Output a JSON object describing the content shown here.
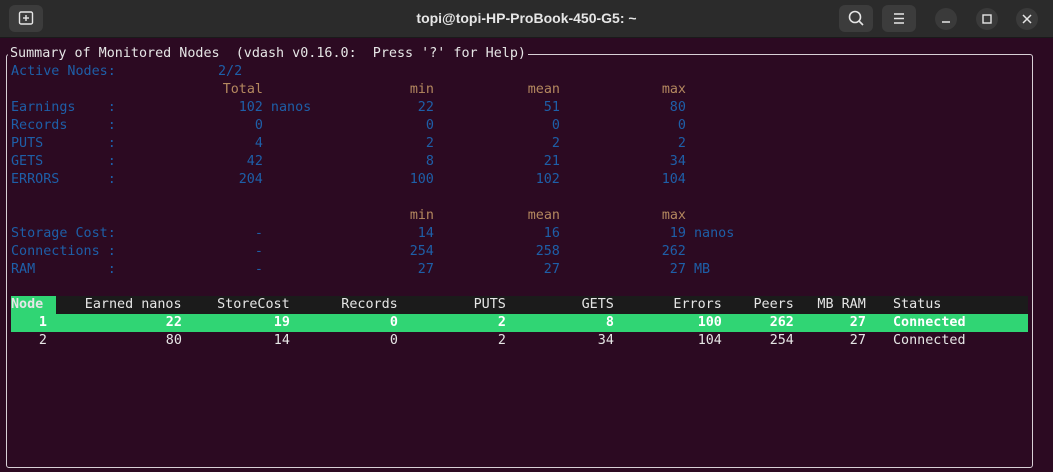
{
  "window": {
    "title": "topi@topi-HP-ProBook-450-G5: ~"
  },
  "header": "Summary of Monitored Nodes  (vdash v0.16.0:  Press '?' for Help)",
  "summary": {
    "active_label": "Active Nodes:",
    "active_value": "2/2",
    "headers": {
      "total": "Total",
      "min": "min",
      "mean": "mean",
      "max": "max"
    },
    "rows": [
      {
        "label": "Earnings    :",
        "total": "102 nanos",
        "min": "22",
        "mean": "51",
        "max": "80"
      },
      {
        "label": "Records     :",
        "total": "0",
        "min": "0",
        "mean": "0",
        "max": "0"
      },
      {
        "label": "PUTS        :",
        "total": "4",
        "min": "2",
        "mean": "2",
        "max": "2"
      },
      {
        "label": "GETS        :",
        "total": "42",
        "min": "8",
        "mean": "21",
        "max": "34"
      },
      {
        "label": "ERRORS      :",
        "total": "204",
        "min": "100",
        "mean": "102",
        "max": "104"
      }
    ],
    "rows2": [
      {
        "label": "Storage Cost:",
        "total": "-",
        "min": "14",
        "mean": "16",
        "max": "19 nanos"
      },
      {
        "label": "Connections :",
        "total": "-",
        "min": "254",
        "mean": "258",
        "max": "262"
      },
      {
        "label": "RAM         :",
        "total": "-",
        "min": "27",
        "mean": "27",
        "max": "27 MB"
      }
    ]
  },
  "table": {
    "headers": [
      "Node",
      "Earned nanos",
      "StoreCost",
      "Records",
      "PUTS",
      "GETS",
      "Errors",
      "Peers",
      "MB RAM",
      "Status"
    ],
    "rows": [
      [
        "1",
        "22",
        "19",
        "0",
        "2",
        "8",
        "100",
        "262",
        "27",
        "Connected"
      ],
      [
        "2",
        "80",
        "14",
        "0",
        "2",
        "34",
        "104",
        "254",
        "27",
        "Connected"
      ]
    ],
    "selected_row": 0
  },
  "colors": {
    "label_blue": "#1e5fa8",
    "header_tan": "#b4885f",
    "selection_green": "#30d574",
    "terminal_bg": "#2c0a22"
  }
}
